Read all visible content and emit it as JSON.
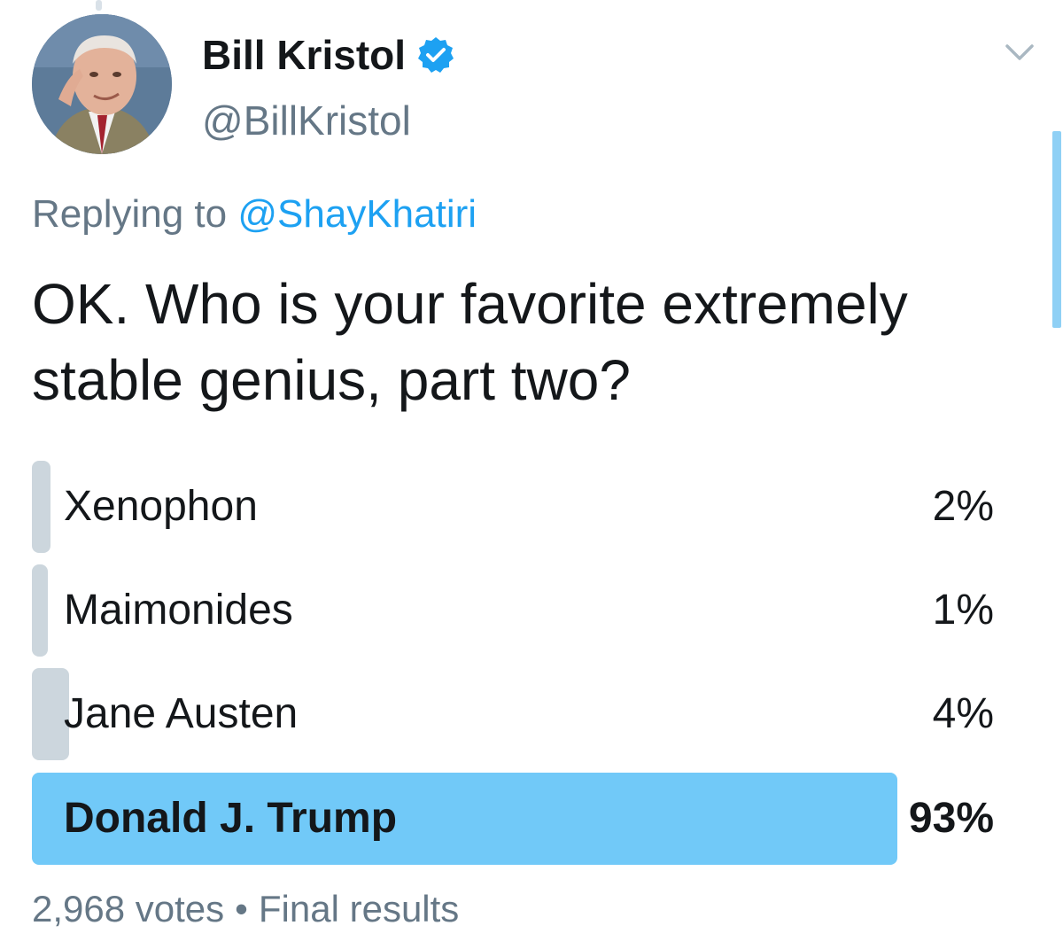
{
  "tweet": {
    "author": {
      "name": "Bill Kristol",
      "handle": "@BillKristol",
      "verified": true
    },
    "reply": {
      "prefix": "Replying to",
      "handle": "@ShayKhatiri"
    },
    "text": "OK. Who is your favorite extremely stable genius, part two?"
  },
  "poll": {
    "options": [
      {
        "label": "Xenophon",
        "percent_label": "2%",
        "percent": 2,
        "winner": false
      },
      {
        "label": "Maimonides",
        "percent_label": "1%",
        "percent": 1,
        "winner": false
      },
      {
        "label": "Jane Austen",
        "percent_label": "4%",
        "percent": 4,
        "winner": false
      },
      {
        "label": "Donald J. Trump",
        "percent_label": "93%",
        "percent": 93,
        "winner": true
      }
    ],
    "votes": "2,968 votes",
    "separator": "•",
    "status": "Final results"
  },
  "colors": {
    "accent": "#1da1f2",
    "winner_bar": "#71c9f8",
    "loser_bar": "#ccd6dd",
    "secondary_text": "#657786",
    "primary_text": "#14171a"
  },
  "icons": {
    "verified": "verified-badge-icon",
    "menu": "chevron-down-icon"
  }
}
